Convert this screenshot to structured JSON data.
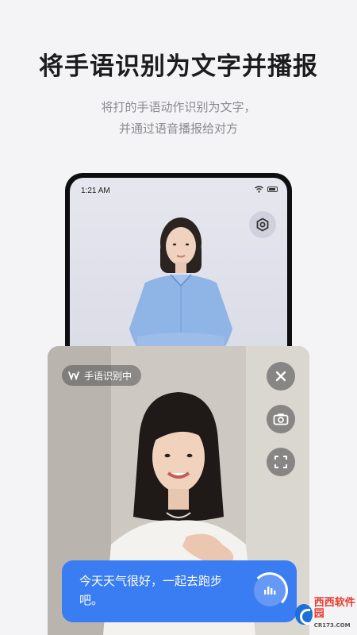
{
  "headline": "将手语识别为文字并播报",
  "subtitle_line1": "将打的手语动作识别为文字，",
  "subtitle_line2": "并通过语音播报给对方",
  "status_bar": {
    "time": "1:21 AM"
  },
  "camera_panel": {
    "recognition_label": "手语识别中",
    "caption_text": "今天天气很好，一起去跑步吧。"
  },
  "watermark": {
    "brand": "西西软件园",
    "domain": "CR173.COM"
  },
  "colors": {
    "accent": "#3a7df2",
    "background": "#f4f4f6"
  },
  "icons": [
    "settings-icon",
    "close-icon",
    "camera-icon",
    "fullscreen-icon",
    "audio-wave-icon",
    "hand-icon"
  ]
}
